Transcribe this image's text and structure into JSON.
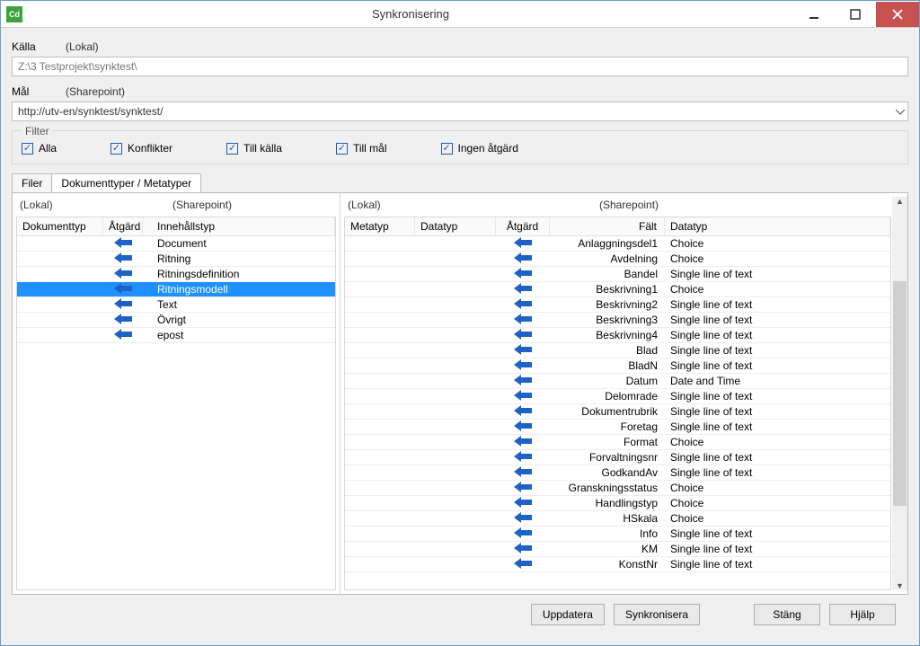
{
  "window": {
    "title": "Synkronisering",
    "icon_text": "Cd"
  },
  "source": {
    "label": "Källa",
    "sub": "(Lokal)",
    "path": "Z:\\3 Testprojekt\\synktest\\"
  },
  "target": {
    "label": "Mål",
    "sub": "(Sharepoint)",
    "url": "http://utv-en/synktest/synktest/"
  },
  "filter": {
    "legend": "Filter",
    "alla": "Alla",
    "konflikter": "Konflikter",
    "till_kalla": "Till källa",
    "till_mal": "Till mål",
    "ingen": "Ingen åtgärd"
  },
  "tabs": {
    "filer": "Filer",
    "doktyper": "Dokumenttyper / Metatyper"
  },
  "left_pane": {
    "lokal": "(Lokal)",
    "sharepoint": "(Sharepoint)",
    "cols": {
      "dokumenttyp": "Dokumenttyp",
      "atgard": "Åtgärd",
      "innehall": "Innehållstyp"
    },
    "rows": [
      {
        "typ": "",
        "innehall": "Document",
        "selected": false
      },
      {
        "typ": "",
        "innehall": "Ritning",
        "selected": false
      },
      {
        "typ": "",
        "innehall": "Ritningsdefinition",
        "selected": false
      },
      {
        "typ": "",
        "innehall": "Ritningsmodell",
        "selected": true
      },
      {
        "typ": "",
        "innehall": "Text",
        "selected": false
      },
      {
        "typ": "",
        "innehall": "Övrigt",
        "selected": false
      },
      {
        "typ": "",
        "innehall": "epost",
        "selected": false
      }
    ]
  },
  "right_pane": {
    "lokal": "(Lokal)",
    "sharepoint": "(Sharepoint)",
    "cols": {
      "metatyp": "Metatyp",
      "datatyp": "Datatyp",
      "atgard": "Åtgärd",
      "falt": "Fält",
      "datatyp2": "Datatyp"
    },
    "rows": [
      {
        "falt": "Anlaggningsdel1",
        "datatyp": "Choice"
      },
      {
        "falt": "Avdelning",
        "datatyp": "Choice"
      },
      {
        "falt": "Bandel",
        "datatyp": "Single line of text"
      },
      {
        "falt": "Beskrivning1",
        "datatyp": "Choice"
      },
      {
        "falt": "Beskrivning2",
        "datatyp": "Single line of text"
      },
      {
        "falt": "Beskrivning3",
        "datatyp": "Single line of text"
      },
      {
        "falt": "Beskrivning4",
        "datatyp": "Single line of text"
      },
      {
        "falt": "Blad",
        "datatyp": "Single line of text"
      },
      {
        "falt": "BladN",
        "datatyp": "Single line of text"
      },
      {
        "falt": "Datum",
        "datatyp": "Date and Time"
      },
      {
        "falt": "Delomrade",
        "datatyp": "Single line of text"
      },
      {
        "falt": "Dokumentrubrik",
        "datatyp": "Single line of text"
      },
      {
        "falt": "Foretag",
        "datatyp": "Single line of text"
      },
      {
        "falt": "Format",
        "datatyp": "Choice"
      },
      {
        "falt": "Forvaltningsnr",
        "datatyp": "Single line of text"
      },
      {
        "falt": "GodkandAv",
        "datatyp": "Single line of text"
      },
      {
        "falt": "Granskningsstatus",
        "datatyp": "Choice"
      },
      {
        "falt": "Handlingstyp",
        "datatyp": "Choice"
      },
      {
        "falt": "HSkala",
        "datatyp": "Choice"
      },
      {
        "falt": "Info",
        "datatyp": "Single line of text"
      },
      {
        "falt": "KM",
        "datatyp": "Single line of text"
      },
      {
        "falt": "KonstNr",
        "datatyp": "Single line of text"
      }
    ]
  },
  "buttons": {
    "uppdatera": "Uppdatera",
    "synkronisera": "Synkronisera",
    "stang": "Stäng",
    "hjalp": "Hjälp"
  }
}
